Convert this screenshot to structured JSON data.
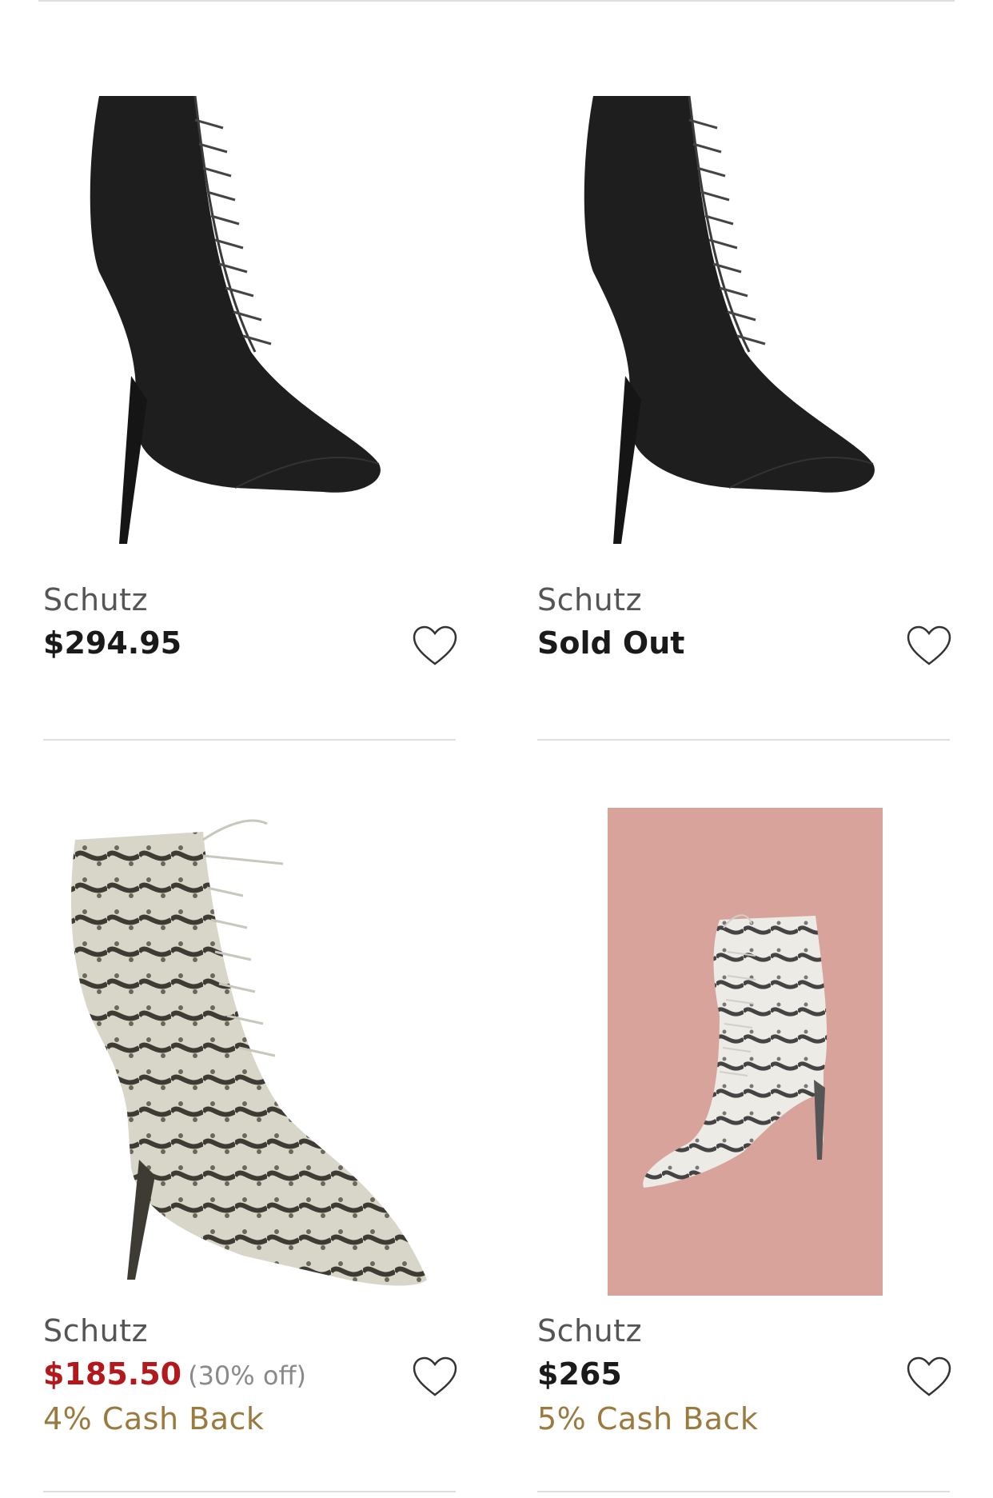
{
  "products": [
    {
      "brand": "Schutz",
      "price": "$294.95",
      "favorite_icon": "heart-outline-icon"
    },
    {
      "brand": "Schutz",
      "price": "Sold Out",
      "favorite_icon": "heart-outline-icon"
    },
    {
      "brand": "Schutz",
      "price": "$185.50",
      "discount": "(30% off)",
      "cashback": "4% Cash Back",
      "favorite_icon": "heart-outline-icon"
    },
    {
      "brand": "Schutz",
      "price": "$265",
      "cashback": "5% Cash Back",
      "favorite_icon": "heart-outline-icon"
    }
  ],
  "colors": {
    "sale_price": "#b3181c",
    "cashback": "#9a7a3f",
    "image_background_pink": "#d7a39b",
    "divider": "#dedede"
  }
}
